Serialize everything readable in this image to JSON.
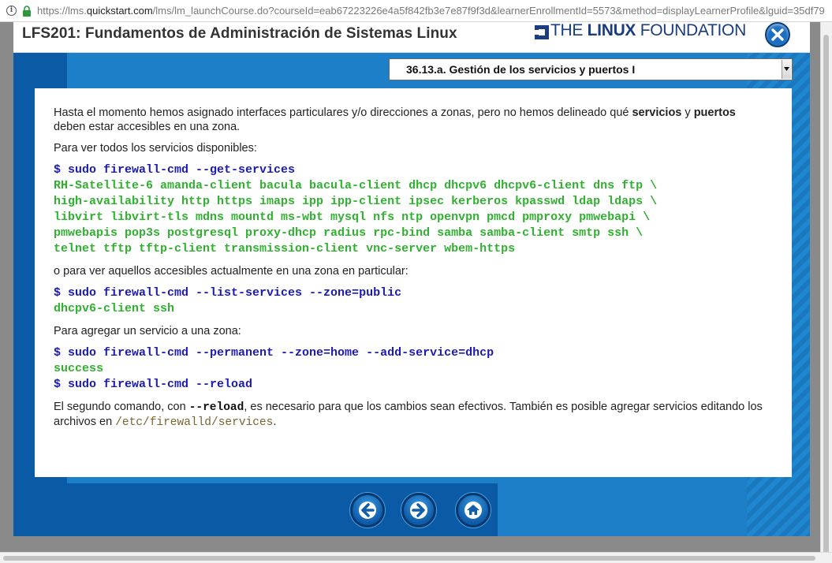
{
  "browser": {
    "url_prefix": "https://lms.",
    "url_domain": "quickstart.com",
    "url_rest": "/lms/lm_launchCourse.do?courseId=eab67223226e4a5f842fb3e7e87f9f3d&learnerEnrollmentId=5573&method=displayLearnerProfile&lguid=35df79"
  },
  "course": {
    "title": "LFS201: Fundamentos de Administración de Sistemas Linux",
    "logo": {
      "part1": "THE ",
      "part2": "LINUX",
      "part3": " FOUNDATION"
    },
    "section_selected": "36.13.a. Gestión de los servicios y puertos I"
  },
  "content": {
    "intro_text_1": "Hasta el momento hemos asignado interfaces particulares y/o direcciones a zonas, pero no hemos delineado qué ",
    "intro_bold_1": "servicios",
    "intro_text_2": " y ",
    "intro_bold_2": "puertos",
    "intro_text_3": "deben estar accesibles en una zona.",
    "para_all_services": "Para ver todos los servicios disponibles:",
    "cmd_get_services": "$ sudo firewall-cmd --get-services",
    "services_output": [
      "RH-Satellite-6 amanda-client bacula bacula-client dhcp dhcpv6 dhcpv6-client dns ftp \\",
      "high-availability http https imaps ipp ipp-client ipsec kerberos kpasswd ldap ldaps \\",
      "libvirt libvirt-tls mdns mountd ms-wbt mysql nfs ntp openvpn pmcd pmproxy pmwebapi \\",
      "pmwebapis pop3s postgresql proxy-dhcp radius rpc-bind samba samba-client smtp ssh \\",
      "telnet tftp tftp-client transmission-client vnc-server wbem-https"
    ],
    "para_zone_services": "o para ver aquellos accesibles actualmente en una zona en particular:",
    "cmd_list_services": "$ sudo firewall-cmd --list-services --zone=public",
    "list_output": "dhcpv6-client ssh",
    "para_add_service": "Para agregar un servicio a una zona:",
    "cmd_add_service": "$ sudo firewall-cmd --permanent --zone=home --add-service=dhcp",
    "add_output": "success",
    "cmd_reload": "$ sudo firewall-cmd --reload",
    "final_text_1": "El segundo comando, con ",
    "final_reload": "--reload",
    "final_text_2": ", es necesario para que los cambios sean efectivos. También es posible agregar servicios editando los",
    "final_text_3": "archivos en ",
    "final_path": "/etc/firewalld/services",
    "final_text_4": "."
  },
  "nav": {
    "back_icon": "arrow-left-icon",
    "next_icon": "arrow-right-icon",
    "home_icon": "home-icon",
    "accent_color": "#1c7fc7"
  }
}
